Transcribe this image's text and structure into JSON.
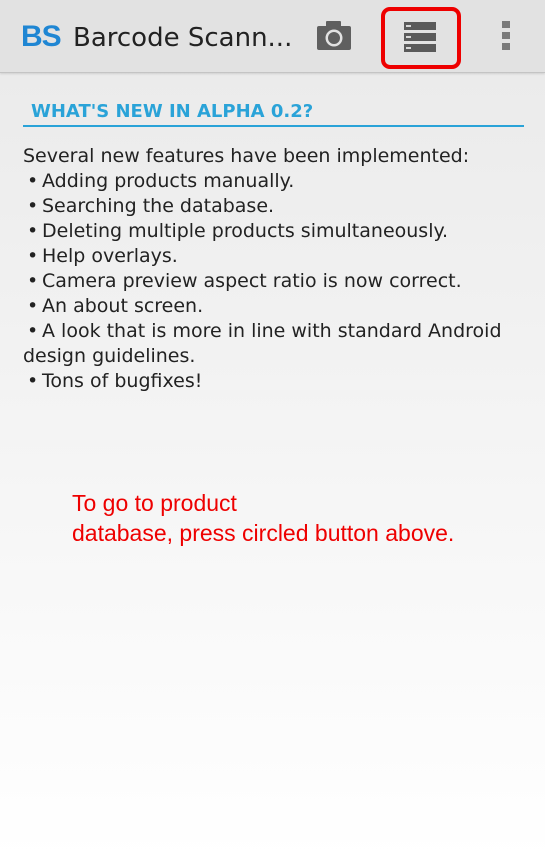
{
  "action_bar": {
    "logo": "BS",
    "title": "Barcode Scann...",
    "icons": {
      "camera": "camera-icon",
      "list": "list-icon",
      "overflow": "overflow-menu-icon"
    },
    "highlight_color": "#ee0000"
  },
  "content": {
    "section_header": "WHAT'S NEW IN ALPHA 0.2?",
    "intro": "Several new features have been implemented:",
    "features": [
      "Adding products manually.",
      "Searching the database.",
      "Deleting multiple products simultaneously.",
      "Help overlays.",
      "Camera preview aspect ratio is now correct.",
      "An about screen.",
      "A look that is more in line with standard Android design guidelines.",
      "Tons of bugfixes!"
    ],
    "bullet": "•",
    "accent_color": "#2aa3d8"
  },
  "hint": {
    "line1": "To go to product",
    "line2": "database, press circled button above.",
    "color": "#ee0000"
  }
}
